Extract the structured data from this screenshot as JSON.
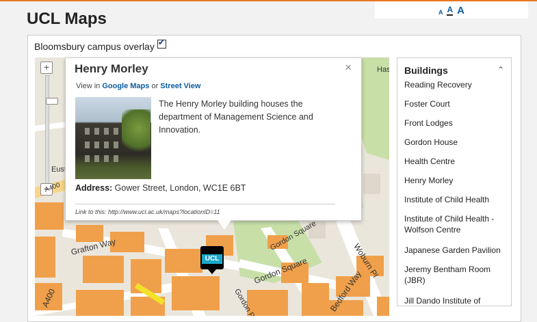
{
  "header": {
    "title": "UCL Maps"
  },
  "text_size": {
    "small": "A",
    "medium": "A",
    "large": "A"
  },
  "overlay": {
    "label": "Bloomsbury campus overlay",
    "checked": true
  },
  "map": {
    "zoom_in": "+",
    "zoom_out": "−",
    "labels": {
      "hastings": "Hast",
      "euston": "Eust",
      "a400_top": "A400",
      "grafton_way": "Grafton Way",
      "a400": "A400",
      "gordon_square_top": "Gordon Square",
      "gordon_square": "Gordon Square",
      "woburn_pl": "Woburn Pl",
      "bedford_way": "Bedford Way",
      "gordon_pl": "Gordon Pl"
    },
    "marker_label": "UCL"
  },
  "popup": {
    "title": "Henry Morley",
    "close": "×",
    "view_in_prefix": "View in",
    "google_maps": "Google Maps",
    "or": "or",
    "street_view": "Street View",
    "description": "The Henry Morley building houses the department of Management Science and Innovation.",
    "address_label": "Address:",
    "address_value": "Gower Street, London, WC1E 6BT",
    "permalink": "Link to this: http://www.ucl.ac.uk/maps?locationID=11"
  },
  "sidebar": {
    "heading": "Buildings",
    "items": [
      "Reading Recovery",
      "Foster Court",
      "Front Lodges",
      "Gordon House",
      "Health Centre",
      "Henry Morley",
      "Institute of Child Health",
      "Institute of Child Health - Wolfson Centre",
      "Japanese Garden Pavilion",
      "Jeremy Bentham Room (JBR)",
      "Jill Dando Institute of"
    ]
  },
  "colors": {
    "accent": "#e87722",
    "link": "#0a5c9e",
    "building": "#f0a04b",
    "park": "#c8dfa8"
  }
}
